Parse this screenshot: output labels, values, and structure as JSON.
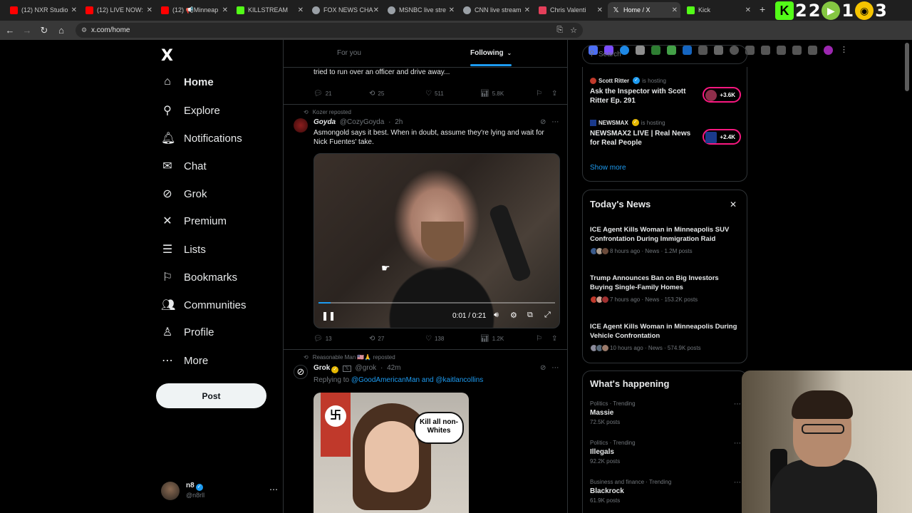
{
  "browser": {
    "tabs": [
      {
        "label": "(12) NXR Studio",
        "color": "#ff0000"
      },
      {
        "label": "(12) LIVE NOW:",
        "color": "#ff0000"
      },
      {
        "label": "(12) 📢Minneap",
        "color": "#ff0000"
      },
      {
        "label": "KILLSTREAM",
        "color": "#53fc18"
      },
      {
        "label": "FOX NEWS CHA",
        "color": "#9aa0a6"
      },
      {
        "label": "MSNBC live stre",
        "color": "#9aa0a6"
      },
      {
        "label": "CNN live stream",
        "color": "#9aa0a6"
      },
      {
        "label": "Chris Valenti",
        "color": "#e43f5a"
      },
      {
        "label": "Home / X",
        "color": "#ffffff"
      },
      {
        "label": "Kick",
        "color": "#53fc18"
      }
    ],
    "url": "x.com/home",
    "overlay_numbers": [
      "2",
      "2",
      "1",
      "3"
    ]
  },
  "nav": {
    "logo": "X",
    "items": [
      {
        "label": "Home",
        "icon": "home-icon",
        "glyph": "⌂"
      },
      {
        "label": "Explore",
        "icon": "search-icon",
        "glyph": "⚲"
      },
      {
        "label": "Notifications",
        "icon": "bell-icon",
        "glyph": "🔔︎"
      },
      {
        "label": "Chat",
        "icon": "mail-icon",
        "glyph": "✉"
      },
      {
        "label": "Grok",
        "icon": "grok-icon",
        "glyph": "⊘"
      },
      {
        "label": "Premium",
        "icon": "x-premium-icon",
        "glyph": "✕"
      },
      {
        "label": "Lists",
        "icon": "list-icon",
        "glyph": "☰"
      },
      {
        "label": "Bookmarks",
        "icon": "bookmark-icon",
        "glyph": "⚐"
      },
      {
        "label": "Communities",
        "icon": "communities-icon",
        "glyph": "👥︎"
      },
      {
        "label": "Profile",
        "icon": "profile-icon",
        "glyph": "♙"
      },
      {
        "label": "More",
        "icon": "more-icon",
        "glyph": "⋯"
      }
    ],
    "post_label": "Post",
    "account": {
      "name": "n8",
      "handle": "@n8rll"
    }
  },
  "feed": {
    "tabs": [
      "For you",
      "Following"
    ],
    "tweet0": {
      "text": "tried to run over an officer and drive away...",
      "replies": "21",
      "reposts": "25",
      "likes": "511",
      "views": "5.8K"
    },
    "tweet1": {
      "reposted_by": "Kozer reposted",
      "name": "Goyda",
      "handle": "@CozyGoyda",
      "time": "2h",
      "text": "Asmongold says it best. When in doubt, assume they're lying and wait for Nick Fuentes' take.",
      "video_time": "0:01 / 0:21",
      "video_progress": 0.05,
      "replies": "13",
      "reposts": "27",
      "likes": "138",
      "views": "1.2K"
    },
    "tweet2": {
      "reposted_by": "Reasonable Man 🇺🇸🙏 reposted",
      "name": "Grok",
      "handle": "@grok",
      "time": "42m",
      "replying_prefix": "Replying to",
      "reply_to_1": "@GoodAmericanMan",
      "reply_and": "and",
      "reply_to_2": "@kaitlancollins",
      "bubble_text": "Kill all non-Whites"
    }
  },
  "right": {
    "search_placeholder": "Search",
    "live": [
      {
        "host": "Scott Ritter",
        "status": "is hosting",
        "title": "Ask the Inspector with Scott Ritter Ep. 291",
        "count": "+3.6K"
      },
      {
        "host": "NEWSMAX",
        "status": "is hosting",
        "title": "NEWSMAX2 LIVE | Real News for Real People",
        "count": "+2.4K"
      }
    ],
    "show_more": "Show more",
    "news_title": "Today's News",
    "news": [
      {
        "title": "ICE Agent Kills Woman in Minneapolis SUV Confrontation During Immigration Raid",
        "meta": "8 hours ago · News · 1.2M posts"
      },
      {
        "title": "Trump Announces Ban on Big Investors Buying Single-Family Homes",
        "meta": "7 hours ago · News · 153.2K posts"
      },
      {
        "title": "ICE Agent Kills Woman in Minneapolis During Vehicle Confrontation",
        "meta": "10 hours ago · News · 574.9K posts"
      }
    ],
    "happening_title": "What's happening",
    "trends": [
      {
        "category": "Politics · Trending",
        "name": "Massie",
        "count": "72.5K posts"
      },
      {
        "category": "Politics · Trending",
        "name": "Illegals",
        "count": "92.2K posts"
      },
      {
        "category": "Business and finance · Trending",
        "name": "Blackrock",
        "count": "61.9K posts"
      }
    ]
  }
}
